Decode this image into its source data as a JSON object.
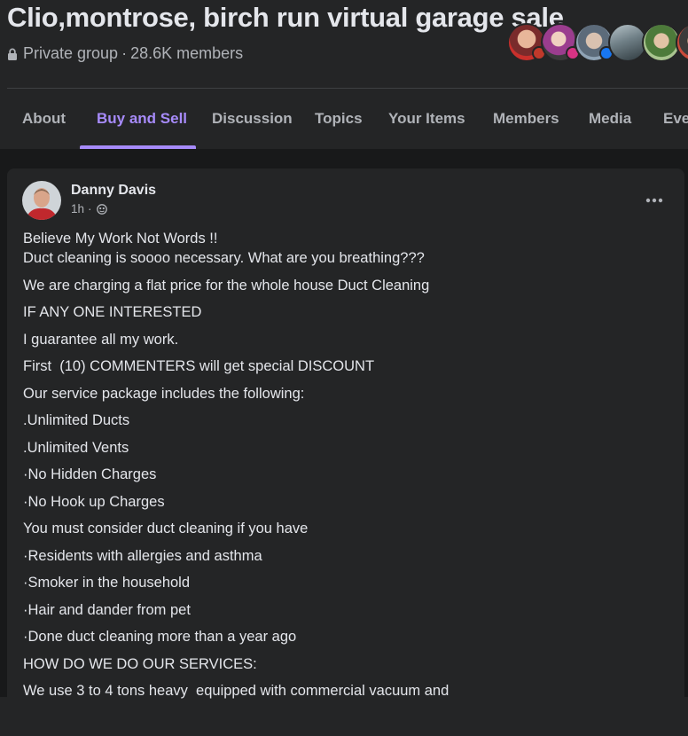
{
  "group": {
    "title": "Clio,montrose, birch run virtual garage sale",
    "privacy": "Private group",
    "separator": "·",
    "members": "28.6K members"
  },
  "tabs": [
    {
      "label": "About"
    },
    {
      "label": "Buy and Sell"
    },
    {
      "label": "Discussion"
    },
    {
      "label": "Topics"
    },
    {
      "label": "Your Items"
    },
    {
      "label": "Members"
    },
    {
      "label": "Media"
    },
    {
      "label": "Events"
    }
  ],
  "active_tab": "Buy and Sell",
  "colors": {
    "accent": "#a78bfa",
    "background": "#242526",
    "feed_background": "#18191a"
  },
  "post": {
    "author": "Danny Davis",
    "time": "1h",
    "time_separator": "·",
    "privacy_icon": "globe-icon",
    "lines": [
      "Believe My Work Not Words !!",
      "Duct cleaning is soooo necessary. What are you breathing???",
      "We are charging a flat price for the whole house Duct Cleaning",
      "IF ANY ONE INTERESTED",
      "I guarantee all my work.",
      "First  (10) COMMENTERS will get special DISCOUNT",
      "Our service package includes the following:",
      ".Unlimited Ducts",
      ".Unlimited Vents",
      "·No Hidden Charges",
      "·No Hook up Charges",
      "You must consider duct cleaning if you have",
      "·Residents with allergies and asthma",
      "·Smoker in the household",
      "·Hair and dander from pet",
      "·Done duct cleaning more than a year ago",
      "HOW DO WE DO OUR SERVICES:",
      "We use 3 to 4 tons heavy  equipped with commercial vacuum and"
    ]
  }
}
